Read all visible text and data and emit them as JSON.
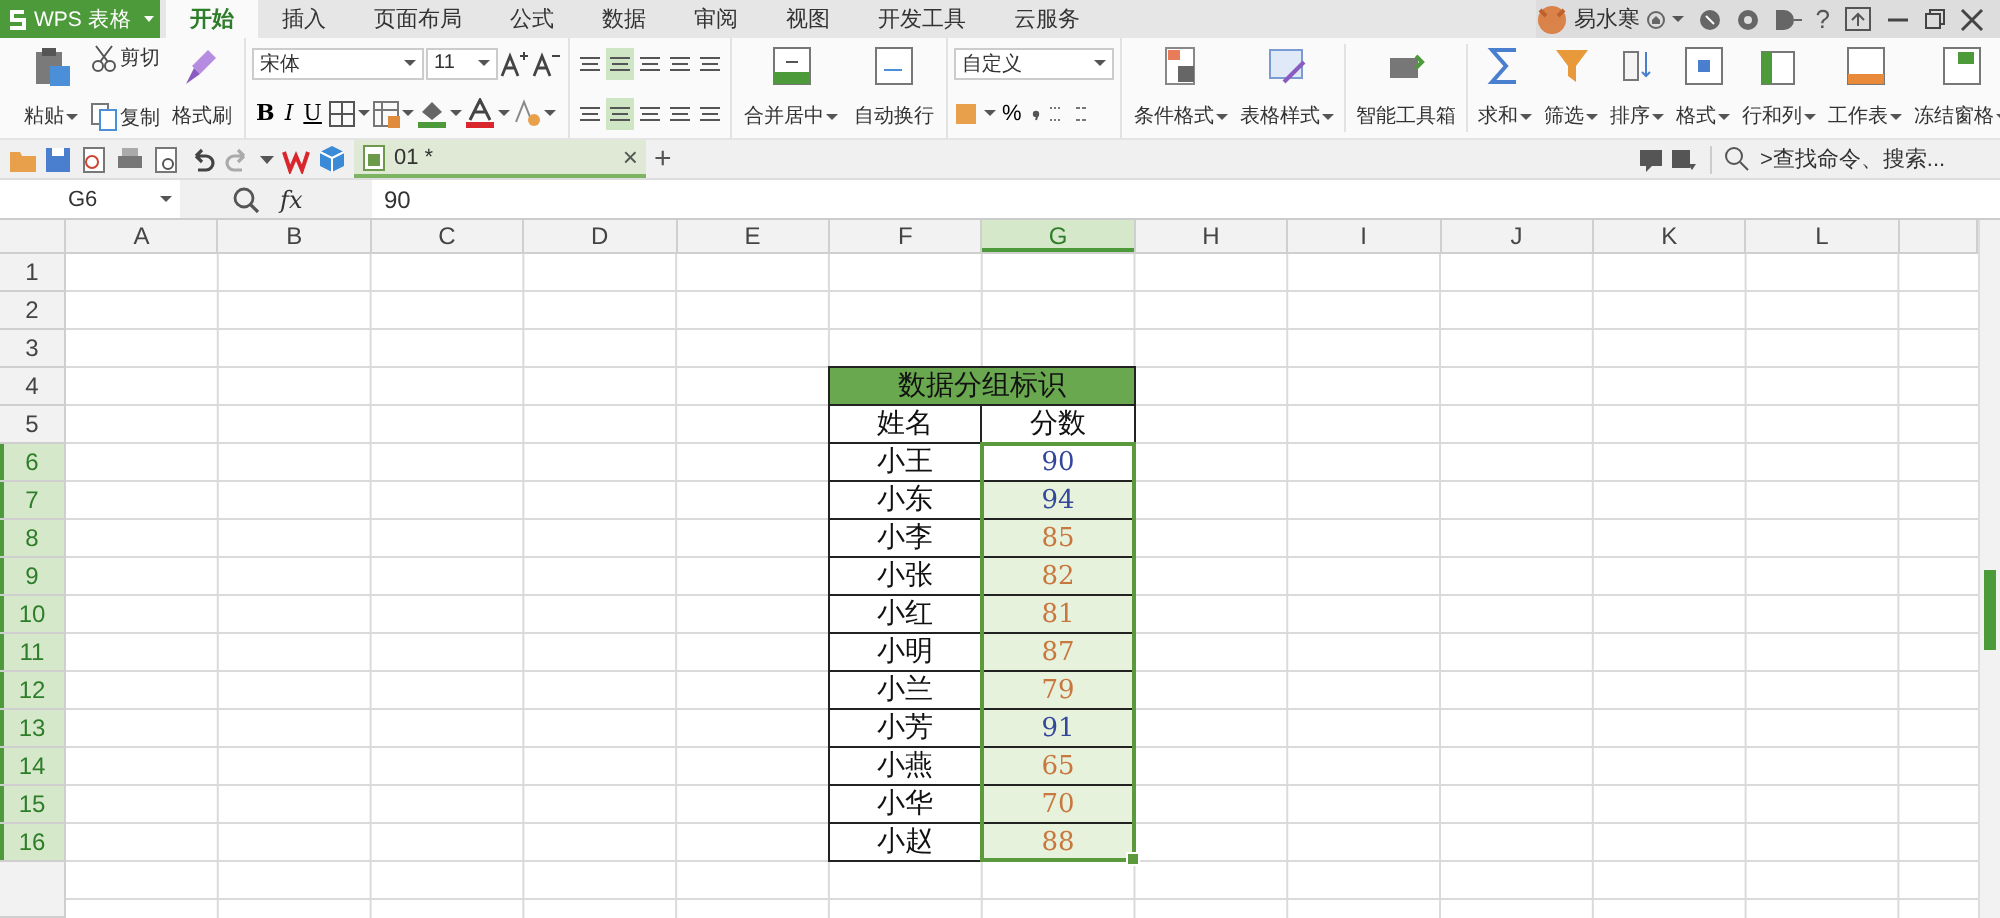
{
  "app": {
    "logo": "WPS 表格"
  },
  "tabs": [
    {
      "label": "开始",
      "selected": true
    },
    {
      "label": "插入",
      "selected": false
    },
    {
      "label": "页面布局",
      "selected": false
    },
    {
      "label": "公式",
      "selected": false
    },
    {
      "label": "数据",
      "selected": false
    },
    {
      "label": "审阅",
      "selected": false
    },
    {
      "label": "视图",
      "selected": false
    },
    {
      "label": "开发工具",
      "selected": false
    },
    {
      "label": "云服务",
      "selected": false
    }
  ],
  "user": {
    "name": "易水寒"
  },
  "help": "?",
  "ribbon": {
    "paste": "粘贴",
    "cut": "剪切",
    "copy": "复制",
    "format_painter": "格式刷",
    "font": "宋体",
    "font_size": "11",
    "bold": "B",
    "italic": "I",
    "underline": "U",
    "number_format": "自定义",
    "percent": "%",
    "align_buttons": [
      {
        "label": "合并居中",
        "dropdown": true
      },
      {
        "label": "自动换行",
        "dropdown": false
      }
    ],
    "tool_buttons": [
      {
        "label": "条件格式",
        "dropdown": true
      },
      {
        "label": "表格样式",
        "dropdown": true
      },
      {
        "label": "智能工具箱",
        "dropdown": false
      },
      {
        "label": "求和",
        "dropdown": true
      },
      {
        "label": "筛选",
        "dropdown": true
      },
      {
        "label": "排序",
        "dropdown": true
      },
      {
        "label": "格式",
        "dropdown": true
      },
      {
        "label": "行和列",
        "dropdown": true
      },
      {
        "label": "工作表",
        "dropdown": true
      },
      {
        "label": "冻结窗格",
        "dropdown": true
      }
    ]
  },
  "document_tab": {
    "title": "01 *",
    "close": "×",
    "new_tab": "+"
  },
  "search": {
    "placeholder": ">查找命令、搜索..."
  },
  "formula_bar": {
    "name_box": "G6",
    "fx": "fx",
    "value": "90"
  },
  "sheet": {
    "columns": [
      {
        "label": "A",
        "selected": false
      },
      {
        "label": "B",
        "selected": false
      },
      {
        "label": "C",
        "selected": false
      },
      {
        "label": "D",
        "selected": false
      },
      {
        "label": "E",
        "selected": false
      },
      {
        "label": "F",
        "selected": false
      },
      {
        "label": "G",
        "selected": true
      },
      {
        "label": "H",
        "selected": false
      },
      {
        "label": "I",
        "selected": false
      },
      {
        "label": "J",
        "selected": false
      },
      {
        "label": "K",
        "selected": false
      },
      {
        "label": "L",
        "selected": false
      }
    ],
    "rows": [
      {
        "label": "1",
        "selected": false
      },
      {
        "label": "2",
        "selected": false
      },
      {
        "label": "3",
        "selected": false
      },
      {
        "label": "4",
        "selected": false
      },
      {
        "label": "5",
        "selected": false
      },
      {
        "label": "6",
        "selected": true
      },
      {
        "label": "7",
        "selected": true
      },
      {
        "label": "8",
        "selected": true
      },
      {
        "label": "9",
        "selected": true
      },
      {
        "label": "10",
        "selected": true
      },
      {
        "label": "11",
        "selected": true
      },
      {
        "label": "12",
        "selected": true
      },
      {
        "label": "13",
        "selected": true
      },
      {
        "label": "14",
        "selected": true
      },
      {
        "label": "15",
        "selected": true
      },
      {
        "label": "16",
        "selected": true
      }
    ],
    "table": {
      "title": "数据分组标识",
      "columns": [
        "姓名",
        "分数"
      ],
      "rows": [
        {
          "name": "小王",
          "score": "90",
          "color": "#34479a",
          "active": true
        },
        {
          "name": "小东",
          "score": "94",
          "color": "#34479a",
          "active": false
        },
        {
          "name": "小李",
          "score": "85",
          "color": "#c8783f",
          "active": false
        },
        {
          "name": "小张",
          "score": "82",
          "color": "#c8783f",
          "active": false
        },
        {
          "name": "小红",
          "score": "81",
          "color": "#c8783f",
          "active": false
        },
        {
          "name": "小明",
          "score": "87",
          "color": "#c8783f",
          "active": false
        },
        {
          "name": "小兰",
          "score": "79",
          "color": "#c8783f",
          "active": false
        },
        {
          "name": "小芳",
          "score": "91",
          "color": "#34479a",
          "active": false
        },
        {
          "name": "小燕",
          "score": "65",
          "color": "#c8783f",
          "active": false
        },
        {
          "name": "小华",
          "score": "70",
          "color": "#c8783f",
          "active": false
        },
        {
          "name": "小赵",
          "score": "88",
          "color": "#c8783f",
          "active": false
        }
      ]
    }
  }
}
